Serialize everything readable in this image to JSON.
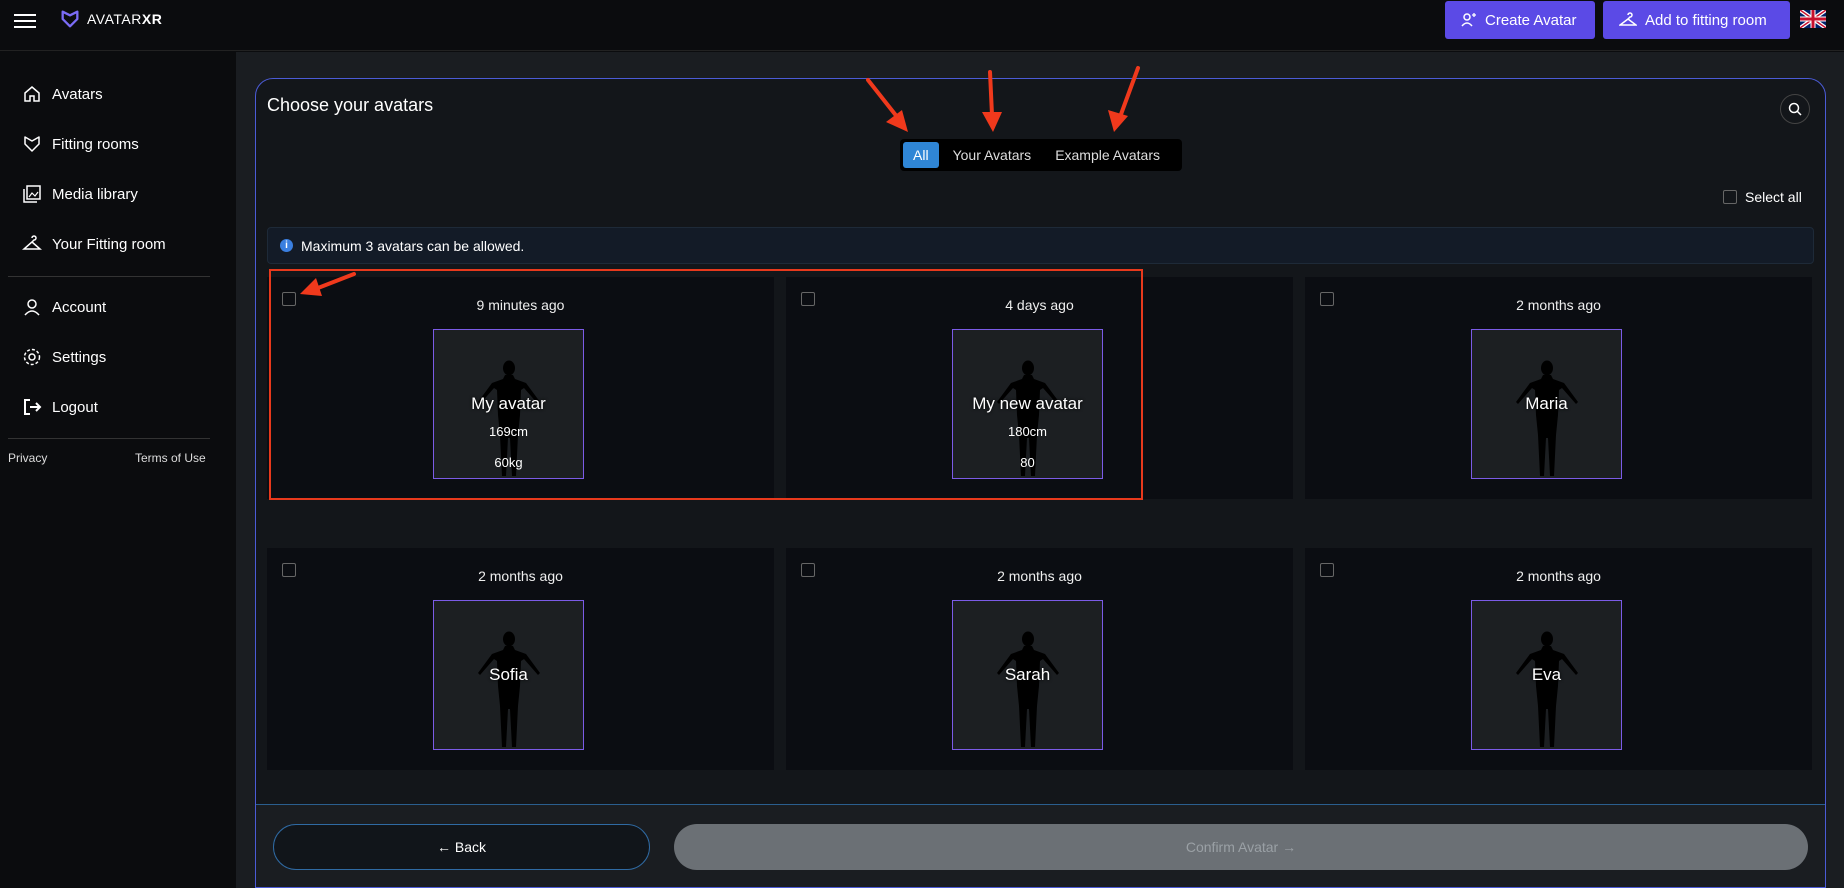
{
  "app": {
    "logo_text_light": "AVATAR",
    "logo_text_bold": "XR"
  },
  "header": {
    "create_label": "Create Avatar",
    "fitting_label": "Add to fitting room"
  },
  "sidebar": {
    "items": [
      {
        "label": "Avatars",
        "icon": "home-icon"
      },
      {
        "label": "Fitting rooms",
        "icon": "fitting-rooms-icon"
      },
      {
        "label": "Media library",
        "icon": "media-library-icon"
      },
      {
        "label": "Your Fitting room",
        "icon": "hanger-icon"
      },
      {
        "label": "Account",
        "icon": "user-icon"
      },
      {
        "label": "Settings",
        "icon": "gear-icon"
      },
      {
        "label": "Logout",
        "icon": "logout-icon"
      }
    ],
    "privacy": "Privacy",
    "terms": "Terms of Use"
  },
  "panel": {
    "title": "Choose your avatars",
    "tabs": [
      {
        "label": "All",
        "active": true
      },
      {
        "label": "Your Avatars",
        "active": false
      },
      {
        "label": "Example Avatars",
        "active": false
      }
    ],
    "select_all": "Select all",
    "info": "Maximum 3 avatars can be allowed."
  },
  "avatars": [
    {
      "time": "9 minutes ago",
      "name": "My avatar",
      "height": "169cm",
      "weight": "60kg"
    },
    {
      "time": "4 days ago",
      "name": "My new avatar",
      "height": "180cm",
      "weight": "80"
    },
    {
      "time": "2 months ago",
      "name": "Maria"
    },
    {
      "time": "2 months ago",
      "name": "Sofia"
    },
    {
      "time": "2 months ago",
      "name": "Sarah"
    },
    {
      "time": "2 months ago",
      "name": "Eva"
    }
  ],
  "footer": {
    "back_label": "← Back",
    "confirm_label": "Confirm Avatar →"
  },
  "colors": {
    "accent": "#5b4ae6",
    "tab_active": "#2f86d6",
    "highlight": "#e8391c"
  }
}
